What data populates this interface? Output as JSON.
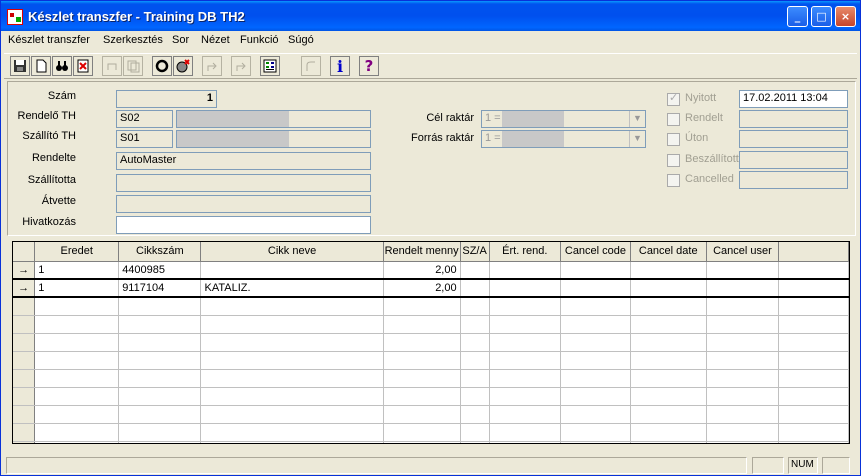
{
  "window": {
    "title": "Készlet transzfer - Training DB TH2"
  },
  "menu": [
    "Készlet transzfer",
    "Szerkesztés",
    "Sor",
    "Nézet",
    "Funkció",
    "Súgó"
  ],
  "toolbar": {
    "icons": [
      "save-icon",
      "new-icon",
      "find-icon",
      "delete-icon",
      "undo-icon",
      "copy-icon",
      "circle-icon",
      "cancel-circle-icon",
      "nav-prev-icon",
      "nav-next-icon",
      "calculator-icon",
      "refresh-icon",
      "info-icon",
      "help-icon"
    ],
    "info_glyph": "i",
    "help_glyph": "?"
  },
  "form": {
    "szam_label": "Szám",
    "szam_value": "1",
    "rendelo_label": "Rendelő TH",
    "rendelo_code": "S02",
    "szallito_label": "Szállító TH",
    "szallito_code": "S01",
    "rendelte_label": "Rendelte",
    "rendelte_value": "AutoMaster",
    "szallitotta_label": "Szállította",
    "szallitotta_value": "",
    "atvette_label": "Átvette",
    "atvette_value": "",
    "hivatkozas_label": "Hivatkozás",
    "hivatkozas_value": "",
    "cel_raktar_label": "Cél raktár",
    "cel_raktar_value": "1 =",
    "forras_raktar_label": "Forrás raktár",
    "forras_raktar_value": "1 =",
    "status": [
      {
        "label": "Nyitott",
        "checked": true,
        "value": "17.02.2011 13:04"
      },
      {
        "label": "Rendelt",
        "checked": false,
        "value": ""
      },
      {
        "label": "Úton",
        "checked": false,
        "value": ""
      },
      {
        "label": "Beszállított",
        "checked": false,
        "value": ""
      },
      {
        "label": "Cancelled",
        "checked": false,
        "value": ""
      }
    ]
  },
  "grid": {
    "columns": [
      "Eredet",
      "Cikkszám",
      "Cikk neve",
      "Rendelt menny",
      "SZ/A",
      "Ért. rend.",
      "Cancel code",
      "Cancel date",
      "Cancel user"
    ],
    "rows": [
      {
        "indicator": "→",
        "eredet": "1",
        "cikkszam": "4400985",
        "cikk_neve": "",
        "rendelt": "2,00"
      },
      {
        "indicator": "→",
        "eredet": "1",
        "cikkszam": "9117104",
        "cikk_neve": "KATALIZ.",
        "rendelt": "2,00"
      }
    ]
  },
  "status_bar": {
    "num": "NUM"
  },
  "colors": {
    "titlebar": "#0054E3",
    "face": "#ECE9D8",
    "info": "#0000CC",
    "help": "#800080"
  }
}
